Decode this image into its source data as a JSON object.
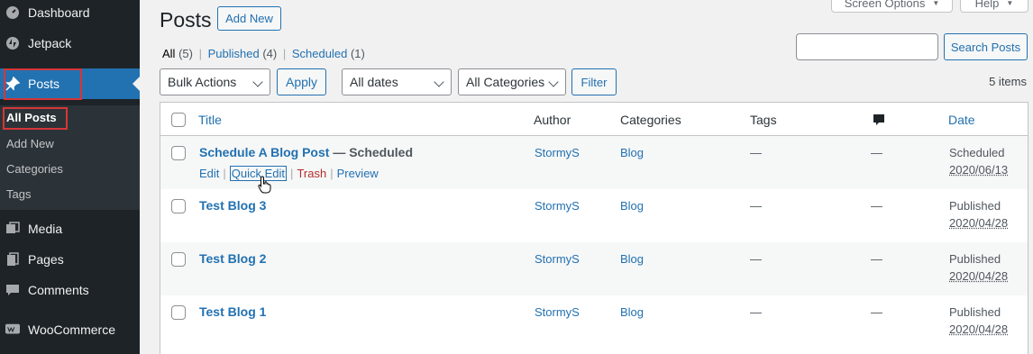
{
  "sidebar": {
    "items": [
      {
        "label": "Dashboard",
        "icon": "dashboard-icon"
      },
      {
        "label": "Jetpack",
        "icon": "jetpack-icon"
      },
      {
        "label": "Posts",
        "icon": "pin-icon"
      },
      {
        "label": "Media",
        "icon": "media-icon"
      },
      {
        "label": "Pages",
        "icon": "pages-icon"
      },
      {
        "label": "Comments",
        "icon": "comments-icon"
      },
      {
        "label": "WooCommerce",
        "icon": "woocommerce-icon"
      }
    ],
    "submenu": [
      "All Posts",
      "Add New",
      "Categories",
      "Tags"
    ],
    "accent": "#2271b1",
    "highlight": "#d63638"
  },
  "header": {
    "title": "Posts",
    "add_new": "Add New",
    "screen_options": "Screen Options",
    "help": "Help"
  },
  "filters": {
    "all": "All",
    "all_count": "(5)",
    "published": "Published",
    "published_count": "(4)",
    "scheduled": "Scheduled",
    "scheduled_count": "(1)",
    "sep": "|"
  },
  "search": {
    "button": "Search Posts",
    "value": ""
  },
  "toolbar": {
    "bulk_actions": "Bulk Actions",
    "apply": "Apply",
    "dates": "All dates",
    "categories": "All Categories",
    "filter": "Filter",
    "items_count": "5 items"
  },
  "table": {
    "columns": {
      "title": "Title",
      "author": "Author",
      "categories": "Categories",
      "tags": "Tags",
      "comments_icon": "comment-bubble-icon",
      "date": "Date"
    },
    "row_actions": {
      "edit": "Edit",
      "quick_edit": "Quick Edit",
      "trash": "Trash",
      "preview": "Preview",
      "sep": "|"
    },
    "rows": [
      {
        "title": "Schedule A Blog Post",
        "state": " — Scheduled",
        "author": "StormyS",
        "category": "Blog",
        "tags": "—",
        "comments": "—",
        "status": "Scheduled",
        "date": "2020/06/13"
      },
      {
        "title": "Test Blog 3",
        "state": "",
        "author": "StormyS",
        "category": "Blog",
        "tags": "—",
        "comments": "—",
        "status": "Published",
        "date": "2020/04/28"
      },
      {
        "title": "Test Blog 2",
        "state": "",
        "author": "StormyS",
        "category": "Blog",
        "tags": "—",
        "comments": "—",
        "status": "Published",
        "date": "2020/04/28"
      },
      {
        "title": "Test Blog 1",
        "state": "",
        "author": "StormyS",
        "category": "Blog",
        "tags": "—",
        "comments": "—",
        "status": "Published",
        "date": "2020/04/28"
      }
    ]
  }
}
